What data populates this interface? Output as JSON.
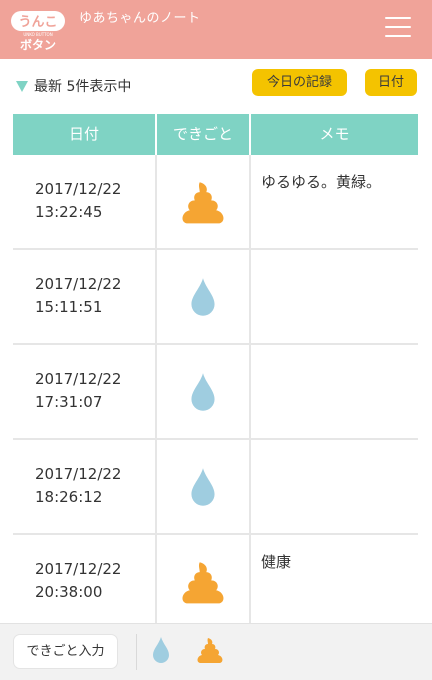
{
  "header": {
    "logo_top": "うんこ",
    "logo_sub": "UNKO BUTTON",
    "logo_bottom": "ボタン",
    "title": "ゆあちゃんのノート"
  },
  "toolbar": {
    "status": "最新 5件表示中",
    "today_record_label": "今日の記録",
    "date_label": "日付"
  },
  "table": {
    "headers": [
      "日付",
      "できごと",
      "メモ"
    ],
    "rows": [
      {
        "date": "2017/12/22",
        "time": "13:22:45",
        "event": "poop",
        "memo": "ゆるゆる。黄緑。"
      },
      {
        "date": "2017/12/22",
        "time": "15:11:51",
        "event": "pee",
        "memo": ""
      },
      {
        "date": "2017/12/22",
        "time": "17:31:07",
        "event": "pee",
        "memo": ""
      },
      {
        "date": "2017/12/22",
        "time": "18:26:12",
        "event": "pee",
        "memo": ""
      },
      {
        "date": "2017/12/22",
        "time": "20:38:00",
        "event": "poop",
        "memo": "健康"
      }
    ]
  },
  "footer": {
    "input_label": "できごと入力"
  },
  "icons": {
    "poop": "poop-icon",
    "pee": "droplet-icon",
    "menu": "hamburger-menu-icon"
  },
  "colors": {
    "header": "#f0a399",
    "accent_teal": "#7fd3c4",
    "button_yellow": "#f4c300",
    "poop": "#f5a533",
    "droplet": "#9fcde0"
  }
}
